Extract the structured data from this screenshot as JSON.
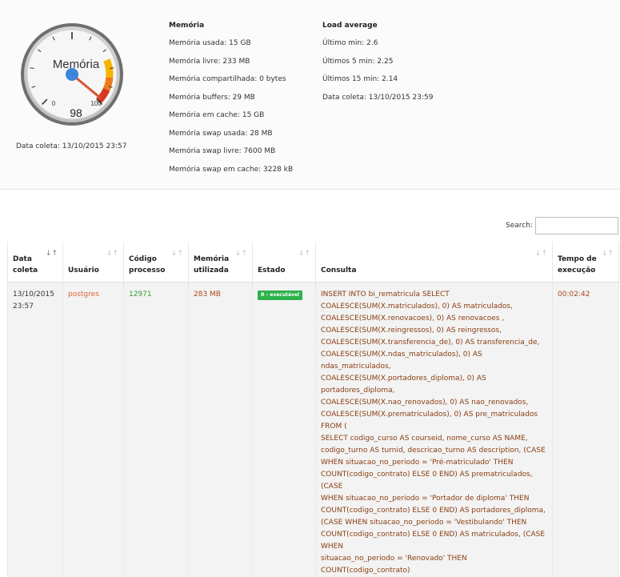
{
  "gauge": {
    "label": "Memória",
    "value": 98,
    "min_label": "0",
    "max_label": "100",
    "caption": "Data coleta: 13/10/2015 23:57",
    "colors": {
      "yellow": "#f5b400",
      "orange": "#f07a1a",
      "red": "#d9381e",
      "needle": "#d9543a",
      "hub": "#3a86d8"
    }
  },
  "memory": {
    "title": "Memória",
    "lines": [
      "Memória usada: 15 GB",
      "Memória livre: 233 MB",
      "Memória compartilhada: 0 bytes",
      "Memória buffers: 29 MB",
      "Memória em cache: 15 GB",
      "Memória swap usada: 28 MB",
      "Memória swap livre: 7600 MB",
      "Memória swap em cache: 3228 kB"
    ]
  },
  "load": {
    "title": "Load average",
    "lines": [
      "Último min: 2.6",
      "Últimos 5 min: 2.25",
      "Últimos 15 min: 2.14",
      "Data coleta: 13/10/2015 23:59"
    ]
  },
  "search": {
    "label": "Search:",
    "value": ""
  },
  "table": {
    "headers": [
      [
        "Data",
        "coleta"
      ],
      [
        "Usuário"
      ],
      [
        "Código",
        "processo"
      ],
      [
        "Memória",
        "utilizada"
      ],
      [
        "Estado"
      ],
      [
        "Consulta"
      ],
      [
        "Tempo de",
        "execução"
      ]
    ],
    "sort_icons": [
      "↓↑",
      "↓↑",
      "↓↑",
      "↓↑",
      "↓↑",
      "↓↑",
      "↓↑"
    ],
    "row": {
      "date": [
        "13/10/2015",
        "23:57"
      ],
      "user": "postgres",
      "pid": "12971",
      "memory": "283 MB",
      "state": "R - executável",
      "query_lines": [
        "INSERT INTO bi_rematricula SELECT",
        "COALESCE(SUM(X.matriculados), 0) AS matriculados,",
        "COALESCE(SUM(X.renovacoes), 0) AS renovacoes ,",
        "COALESCE(SUM(X.reingressos), 0) AS reingressos,",
        "COALESCE(SUM(X.transferencia_de), 0) AS transferencia_de,",
        "COALESCE(SUM(X.ndas_matriculados), 0) AS ndas_matriculados,",
        "COALESCE(SUM(X.portadores_diploma), 0) AS portadores_diploma,",
        "COALESCE(SUM(X.nao_renovados), 0) AS nao_renovados,",
        "COALESCE(SUM(X.prematriculados), 0) AS pre_matriculados FROM (",
        "SELECT codigo_curso AS courseid, nome_curso AS NAME,",
        "codigo_turno AS turnid, descricao_turno AS description, (CASE",
        "WHEN situacao_no_periodo = 'Pré-matriculado' THEN",
        "COUNT(codigo_contrato) ELSE 0 END) AS prematriculados, (CASE",
        "WHEN situacao_no_periodo = 'Portador de diploma' THEN",
        "COUNT(codigo_contrato) ELSE 0 END) AS portadores_diploma,",
        "(CASE WHEN situacao_no_periodo = 'Vestibulando' THEN",
        "COUNT(codigo_contrato) ELSE 0 END) AS matriculados, (CASE WHEN",
        "situacao_no_periodo = 'Renovado' THEN COUNT(codigo_contrato)"
      ],
      "time": "00:02:42"
    }
  }
}
